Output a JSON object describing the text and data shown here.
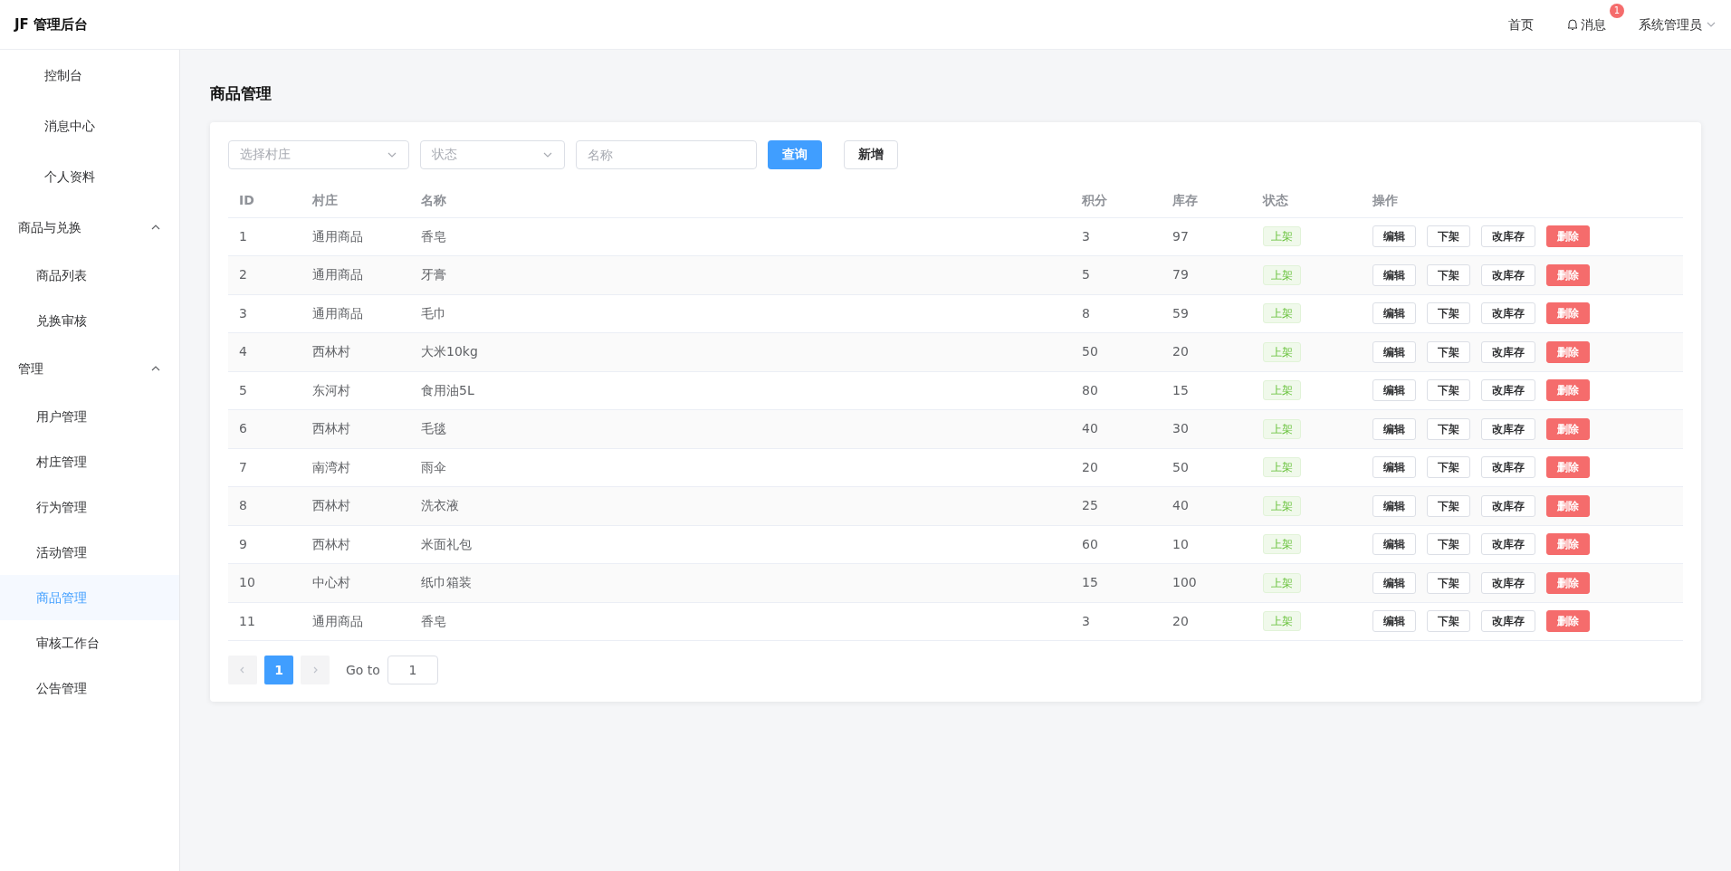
{
  "header": {
    "logo": "JF 管理后台",
    "nav": [
      {
        "kind": "link",
        "label": "首页"
      },
      {
        "kind": "messages",
        "label": "消息",
        "badge": "1"
      },
      {
        "kind": "user",
        "label": "系统管理员"
      }
    ]
  },
  "sidebar": {
    "items": [
      {
        "label": "控制台",
        "selected": false
      },
      {
        "label": "消息中心",
        "selected": false
      },
      {
        "label": "个人资料",
        "selected": false
      },
      {
        "label": "商品与兑换",
        "expanded": true,
        "children": [
          {
            "label": "商品列表",
            "selected": false
          },
          {
            "label": "兑换审核",
            "selected": false
          }
        ]
      },
      {
        "label": "管理",
        "expanded": true,
        "children": [
          {
            "label": "用户管理",
            "selected": false
          },
          {
            "label": "村庄管理",
            "selected": false
          },
          {
            "label": "行为管理",
            "selected": false
          },
          {
            "label": "活动管理",
            "selected": false
          },
          {
            "label": "商品管理",
            "selected": true
          },
          {
            "label": "审核工作台",
            "selected": false
          },
          {
            "label": "公告管理",
            "selected": false
          }
        ]
      }
    ]
  },
  "page_title": "商品管理",
  "filters": {
    "village": {
      "placeholder": "选择村庄"
    },
    "status": {
      "placeholder": "状态"
    },
    "name": {
      "placeholder": "名称"
    },
    "search_button": "查询",
    "add_button": "新增"
  },
  "table": {
    "columns": [
      "ID",
      "村庄",
      "名称",
      "积分",
      "库存",
      "状态",
      "操作"
    ],
    "rows": [
      {
        "id": "1",
        "village": "通用商品",
        "name": "香皂",
        "points": "3",
        "stock": "97",
        "status": "上架",
        "actions": [
          "编辑",
          "下架",
          "改库存",
          "删除"
        ]
      },
      {
        "id": "2",
        "village": "通用商品",
        "name": "牙膏",
        "points": "5",
        "stock": "79",
        "status": "上架",
        "actions": [
          "编辑",
          "下架",
          "改库存",
          "删除"
        ]
      },
      {
        "id": "3",
        "village": "通用商品",
        "name": "毛巾",
        "points": "8",
        "stock": "59",
        "status": "上架",
        "actions": [
          "编辑",
          "下架",
          "改库存",
          "删除"
        ]
      },
      {
        "id": "4",
        "village": "西林村",
        "name": "大米10kg",
        "points": "50",
        "stock": "20",
        "status": "上架",
        "actions": [
          "编辑",
          "下架",
          "改库存",
          "删除"
        ]
      },
      {
        "id": "5",
        "village": "东河村",
        "name": "食用油5L",
        "points": "80",
        "stock": "15",
        "status": "上架",
        "actions": [
          "编辑",
          "下架",
          "改库存",
          "删除"
        ]
      },
      {
        "id": "6",
        "village": "西林村",
        "name": "毛毯",
        "points": "40",
        "stock": "30",
        "status": "上架",
        "actions": [
          "编辑",
          "下架",
          "改库存",
          "删除"
        ]
      },
      {
        "id": "7",
        "village": "南湾村",
        "name": "雨伞",
        "points": "20",
        "stock": "50",
        "status": "上架",
        "actions": [
          "编辑",
          "下架",
          "改库存",
          "删除"
        ]
      },
      {
        "id": "8",
        "village": "西林村",
        "name": "洗衣液",
        "points": "25",
        "stock": "40",
        "status": "上架",
        "actions": [
          "编辑",
          "下架",
          "改库存",
          "删除"
        ]
      },
      {
        "id": "9",
        "village": "西林村",
        "name": "米面礼包",
        "points": "60",
        "stock": "10",
        "status": "上架",
        "actions": [
          "编辑",
          "下架",
          "改库存",
          "删除"
        ]
      },
      {
        "id": "10",
        "village": "中心村",
        "name": "纸巾箱装",
        "points": "15",
        "stock": "100",
        "status": "上架",
        "actions": [
          "编辑",
          "下架",
          "改库存",
          "删除"
        ]
      },
      {
        "id": "11",
        "village": "通用商品",
        "name": "香皂",
        "points": "3",
        "stock": "20",
        "status": "上架",
        "actions": [
          "编辑",
          "下架",
          "改库存",
          "删除"
        ]
      }
    ]
  },
  "pagination": {
    "pages": [
      {
        "label": "1",
        "selected": true
      }
    ],
    "goto_label": "Go to",
    "goto_value": "1"
  }
}
